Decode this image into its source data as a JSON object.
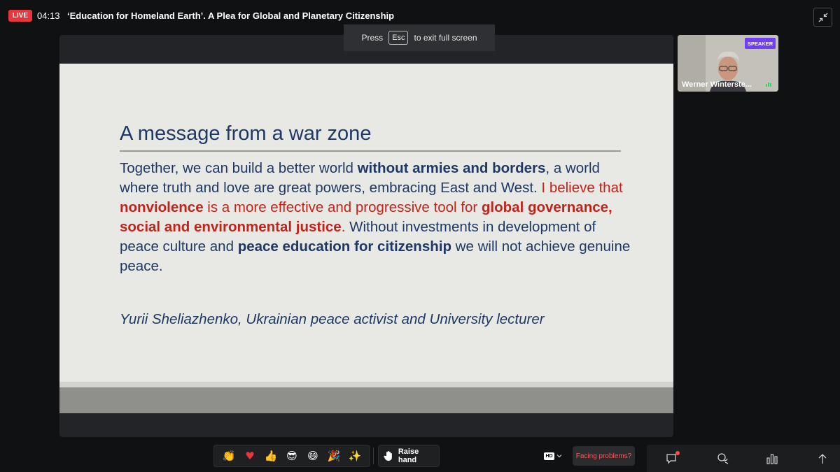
{
  "topbar": {
    "live_label": "LIVE",
    "timer": "04:13",
    "title": "‘Education for Homeland Earth’. A Plea for Global and Planetary Citizenship",
    "exit_fullscreen_icon": "minimize-arrows-icon"
  },
  "fullscreen_notice": {
    "press": "Press",
    "key": "Esc",
    "rest": "to exit full screen"
  },
  "slide": {
    "heading": "A message from a war zone",
    "body": {
      "p1": "Together, we can build a better world ",
      "p1_bold": "without armies and borders",
      "p2": ", a world where truth and love are great powers, embracing East and West. ",
      "r1": "I believe that ",
      "r1_bold": "nonviolence",
      "r2": " is a more effective and progressive tool for ",
      "r2_bold": "global governance, social and environmental justice",
      "r3": ".",
      "p3": " Without investments in development of peace culture and ",
      "p3_bold": "peace education for citizenship",
      "p4": " we will not achieve genuine peace."
    },
    "attribution": "Yurii Sheliazhenko, Ukrainian peace activist and University lecturer",
    "colors": {
      "navy": "#1f3864",
      "red": "#c0251b"
    }
  },
  "speaker": {
    "badge": "SPEAKER",
    "name": "Werner Wintersteiner",
    "name_display": "Werner Winterste..."
  },
  "controls": {
    "reactions": [
      "clap-emoji",
      "heart-emoji",
      "thumbs-up-emoji",
      "cool-face-emoji",
      "laughing-emoji",
      "party-popper-emoji",
      "wow-emoji"
    ],
    "raise_hand": "Raise hand",
    "quality": "HD",
    "facing_problems": "Facing problems?",
    "side_icons": [
      "chat-icon",
      "qna-icon",
      "poll-icon",
      "more-icon"
    ]
  },
  "colors": {
    "live_red": "#e8373c",
    "speaker_purple": "#6e3ff3",
    "accent_red": "#ef5a5a"
  }
}
